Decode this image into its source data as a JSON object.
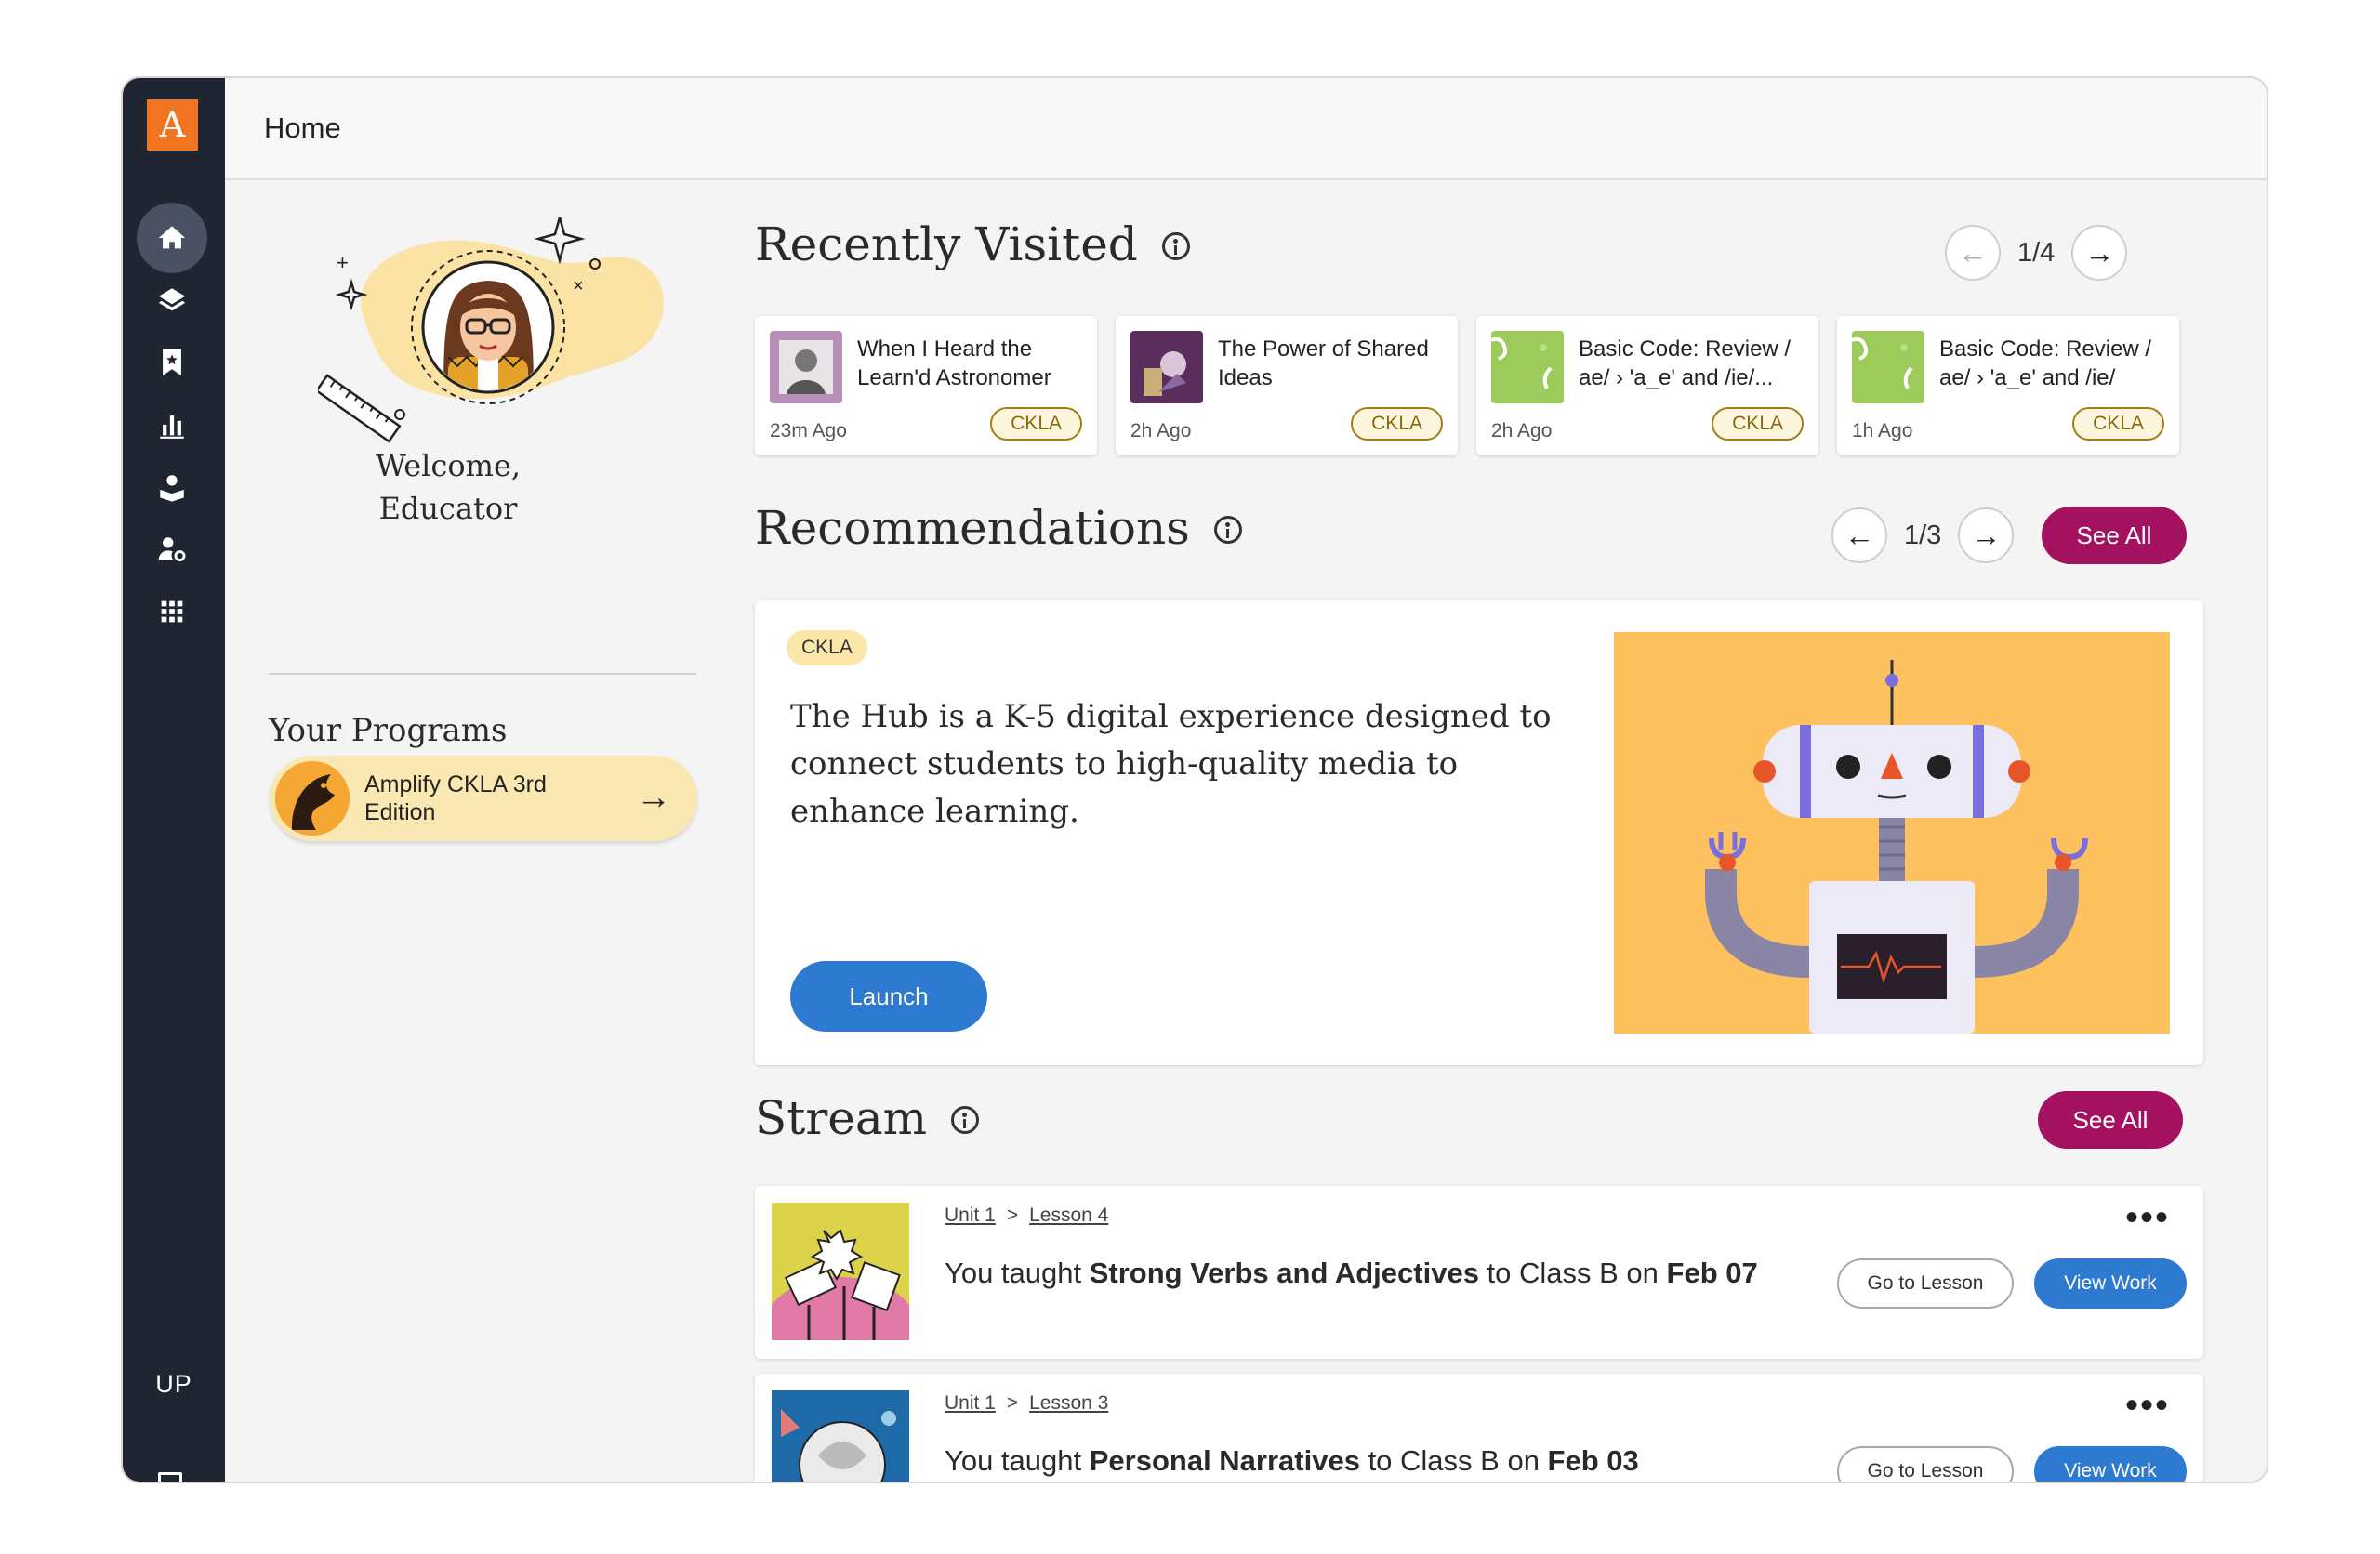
{
  "app": {
    "logo_letter": "A",
    "page_title": "Home"
  },
  "sidebar": {
    "items": [
      {
        "name": "home",
        "icon": "home-icon",
        "active": true
      },
      {
        "name": "library",
        "icon": "layers-icon"
      },
      {
        "name": "bookmarks",
        "icon": "bookmark-star-icon"
      },
      {
        "name": "reports",
        "icon": "bar-chart-icon"
      },
      {
        "name": "teacher",
        "icon": "reader-icon"
      },
      {
        "name": "user-settings",
        "icon": "user-gear-icon"
      },
      {
        "name": "apps",
        "icon": "grid-icon"
      }
    ],
    "user_initials": "UP"
  },
  "welcome": {
    "line1": "Welcome,",
    "line2": "Educator"
  },
  "programs": {
    "title": "Your Programs",
    "items": [
      {
        "label": "Amplify CKLA 3rd Edition"
      }
    ]
  },
  "recently_visited": {
    "title": "Recently Visited",
    "page": "1/4",
    "cards": [
      {
        "title": "When I Heard the Learn'd Astronomer",
        "time": "23m Ago",
        "badge": "CKLA"
      },
      {
        "title": "The Power of Shared Ideas",
        "time": "2h Ago",
        "badge": "CKLA"
      },
      {
        "title": "Basic Code: Review / ae/ › 'a_e' and /ie/...",
        "time": "2h Ago",
        "badge": "CKLA"
      },
      {
        "title": "Basic Code: Review / ae/ › 'a_e' and /ie/",
        "time": "1h Ago",
        "badge": "CKLA"
      }
    ]
  },
  "recommendations": {
    "title": "Recommendations",
    "page": "1/3",
    "see_all": "See All",
    "card": {
      "badge": "CKLA",
      "text": "The Hub is a K-5 digital experience designed to connect students to high-quality media to enhance learning.",
      "launch": "Launch"
    }
  },
  "stream": {
    "title": "Stream",
    "see_all": "See All",
    "items": [
      {
        "unit": "Unit 1",
        "sep": ">",
        "lesson": "Lesson 4",
        "prefix": "You taught ",
        "topic": "Strong Verbs and Adjectives",
        "mid": " to Class B on ",
        "date": "Feb 07",
        "go": "Go to Lesson",
        "view": "View Work"
      },
      {
        "unit": "Unit 1",
        "sep": ">",
        "lesson": "Lesson 3",
        "prefix": "You taught ",
        "topic": "Personal Narratives",
        "mid": " to Class B on ",
        "date": "Feb 03",
        "go": "Go to Lesson",
        "view": "View Work"
      }
    ]
  },
  "colors": {
    "sidebar": "#1f2531",
    "accent_magenta": "#a3115f",
    "accent_blue": "#2e7ad1",
    "logo": "#f07422"
  }
}
